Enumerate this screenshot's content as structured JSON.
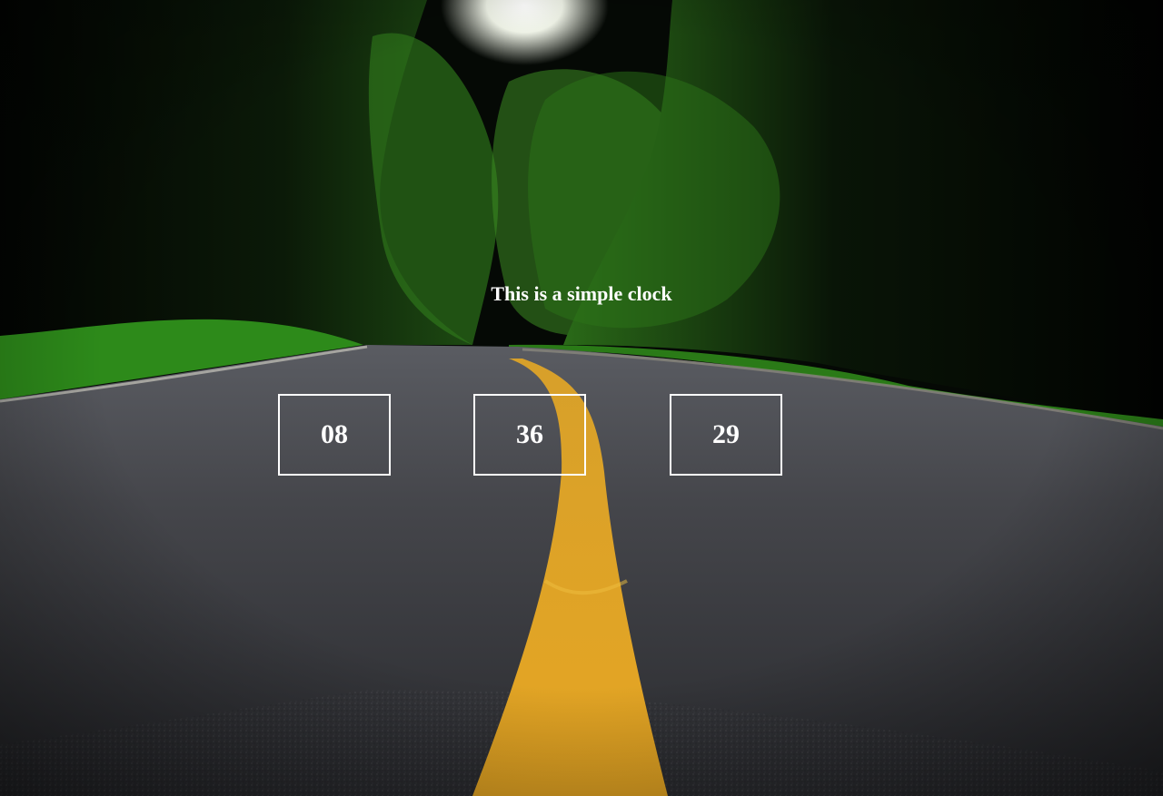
{
  "clock": {
    "title": "This is a simple clock",
    "hours": "08",
    "minutes": "36",
    "seconds": "29"
  },
  "background": {
    "scene": "forest-road",
    "colors": {
      "asphalt": "#3a3b40",
      "center_line": "#e0a020",
      "foliage": "#1f6b12",
      "sky": "#f2f3ee"
    }
  }
}
